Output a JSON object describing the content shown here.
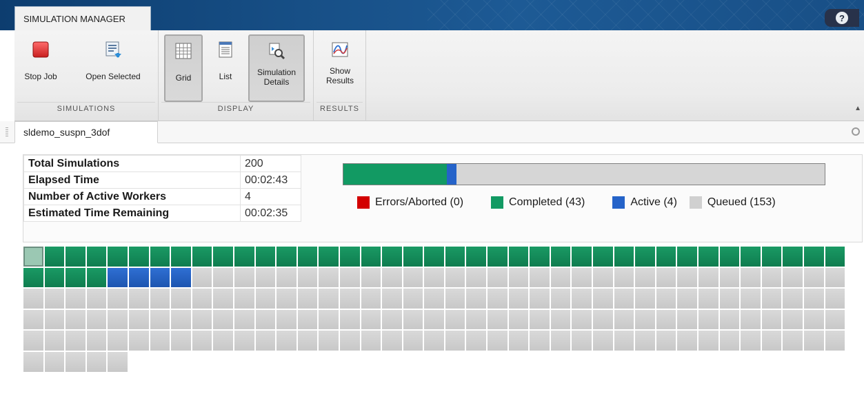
{
  "app": {
    "tab_label": "SIMULATION MANAGER",
    "help_label": "?"
  },
  "toolstrip": {
    "groups": [
      {
        "label": "SIMULATIONS",
        "buttons": [
          {
            "label": "Stop Job",
            "icon": "stop-icon"
          },
          {
            "label": "Open Selected",
            "icon": "open-selected-icon"
          }
        ]
      },
      {
        "label": "DISPLAY",
        "buttons": [
          {
            "label": "Grid",
            "icon": "grid-icon",
            "selected": true
          },
          {
            "label": "List",
            "icon": "list-icon"
          },
          {
            "label": "Simulation\nDetails",
            "icon": "simulation-details-icon",
            "selected": true
          }
        ]
      },
      {
        "label": "RESULTS",
        "buttons": [
          {
            "label": "Show\nResults",
            "icon": "show-results-icon"
          }
        ]
      }
    ]
  },
  "document": {
    "tab_label": "sldemo_suspn_3dof"
  },
  "stats": {
    "rows": [
      {
        "label": "Total Simulations",
        "value": "200"
      },
      {
        "label": "Elapsed Time",
        "value": "00:02:43"
      },
      {
        "label": "Number of Active Workers",
        "value": "4"
      },
      {
        "label": "Estimated Time Remaining",
        "value": "00:02:35"
      }
    ]
  },
  "legend": [
    {
      "label": "Errors/Aborted (0)",
      "status": "errors",
      "color": "#d30000"
    },
    {
      "label": "Completed (43)",
      "status": "completed",
      "color": "#129a63"
    },
    {
      "label": "Active (4)",
      "status": "active",
      "color": "#2563c9"
    },
    {
      "label": "Queued (153)",
      "status": "queued",
      "color": "#d0d0d0"
    }
  ],
  "progress": {
    "total": 200,
    "errors": 0,
    "completed": 43,
    "active": 4,
    "queued": 153
  },
  "grid": {
    "total": 200,
    "completed": 43,
    "active": 4,
    "selected_index": 0
  },
  "colors": {
    "accent": "#1d5a95",
    "completed": "#129a63",
    "active": "#2563c9",
    "queued": "#d0d0d0",
    "errors": "#d30000"
  }
}
